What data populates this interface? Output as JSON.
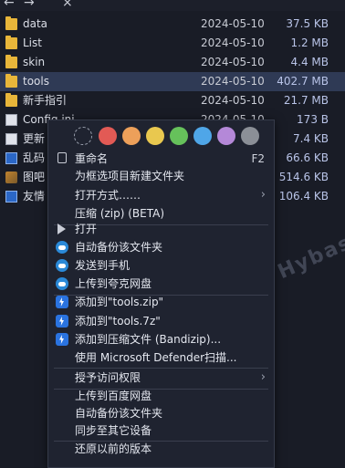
{
  "files": [
    {
      "name": "data",
      "date": "2024-05-10",
      "size": "37.5 KB",
      "type": "folder"
    },
    {
      "name": "List",
      "date": "2024-05-10",
      "size": "1.2 MB",
      "type": "folder"
    },
    {
      "name": "skin",
      "date": "2024-05-10",
      "size": "4.4 MB",
      "type": "folder"
    },
    {
      "name": "tools",
      "date": "2024-05-10",
      "size": "402.7 MB",
      "type": "folder",
      "selected": true
    },
    {
      "name": "新手指引",
      "date": "2024-05-10",
      "size": "21.7 MB",
      "type": "folder"
    },
    {
      "name": "Config.ini",
      "date": "2024-05-10",
      "size": "173 B",
      "type": "doc"
    },
    {
      "name": "更新",
      "date": "",
      "size": "7.4 KB",
      "type": "doc"
    },
    {
      "name": "乱码",
      "date": "",
      "size": "66.6 KB",
      "type": "doc-blue"
    },
    {
      "name": "图吧",
      "date": "",
      "size": "514.6 KB",
      "type": "doc-img"
    },
    {
      "name": "友情",
      "date": "",
      "size": "106.4 KB",
      "type": "doc-blue"
    }
  ],
  "colors": [
    "#e25a55",
    "#eda05a",
    "#e9c84f",
    "#66c15b",
    "#4fa6e8",
    "#b488d8",
    "#8b8f97"
  ],
  "menu": {
    "rename": {
      "label": "重命名",
      "shortcut": "F2"
    },
    "new_folder": "为框选项目新建文件夹",
    "open_with": "打开方式……",
    "compress": "压缩 (zip) (BETA)",
    "open": "打开",
    "auto_backup": "自动备份该文件夹",
    "send_phone": "发送到手机",
    "upload_quark": "上传到夸克网盘",
    "add_zip": "添加到\"tools.zip\"",
    "add_7z": "添加到\"tools.7z\"",
    "add_bandizip": "添加到压缩文件 (Bandizip)...",
    "defender": "使用 Microsoft Defender扫描...",
    "grant_access": "授予访问权限",
    "upload_baidu": "上传到百度网盘",
    "auto_backup2": "自动备份该文件夹",
    "sync_devices": "同步至其它设备",
    "restore": "还原以前的版本"
  },
  "watermark": "藏:黑域基地  Hybase.com"
}
